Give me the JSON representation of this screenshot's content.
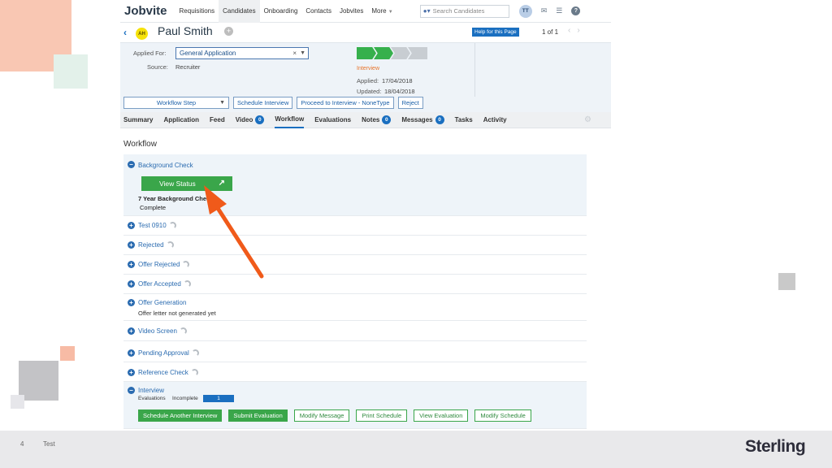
{
  "app": {
    "logo": "Jobvite",
    "nav": [
      "Requisitions",
      "Candidates",
      "Onboarding",
      "Contacts",
      "Jobvites",
      "More"
    ],
    "search_placeholder": "Search Candidates",
    "user_initials": "TT"
  },
  "candidate": {
    "initials": "AH",
    "name": "Paul Smith",
    "help_button": "Help for this Page",
    "pager": "1 of 1"
  },
  "info": {
    "applied_for_label": "Applied For:",
    "applied_for_value": "General Application",
    "source_label": "Source:",
    "source_value": "Recruiter",
    "stage": "Interview",
    "applied_label": "Applied:",
    "applied_date": "17/04/2018",
    "updated_label": "Updated:",
    "updated_date": "18/04/2018",
    "buttons": {
      "workflow_step": "Workflow Step",
      "schedule_interview": "Schedule Interview",
      "proceed": "Proceed to Interview - NoneType",
      "reject": "Reject"
    }
  },
  "tabs": [
    {
      "label": "Summary"
    },
    {
      "label": "Application"
    },
    {
      "label": "Feed"
    },
    {
      "label": "Video",
      "badge": "0"
    },
    {
      "label": "Workflow"
    },
    {
      "label": "Evaluations"
    },
    {
      "label": "Notes",
      "badge": "0"
    },
    {
      "label": "Messages",
      "badge": "0"
    },
    {
      "label": "Tasks"
    },
    {
      "label": "Activity"
    }
  ],
  "workflow": {
    "title": "Workflow",
    "background_check": {
      "name": "Background Check",
      "view_status": "View Status",
      "item": "7 Year Background Check",
      "status": "Complete"
    },
    "steps": [
      "Test 0910",
      "Rejected",
      "Offer Rejected",
      "Offer Accepted",
      "Offer Generation",
      "Video Screen",
      "Pending Approval",
      "Reference Check"
    ],
    "offer_generation_note": "Offer letter not generated yet",
    "interview": {
      "name": "Interview",
      "evaluations_label": "Evaluations",
      "evaluations_status": "Incomplete",
      "progress": "1",
      "actions": [
        "Schedule Another Interview",
        "Submit Evaluation",
        "Modify Message",
        "Print Schedule",
        "View Evaluation",
        "Modify Schedule"
      ]
    }
  },
  "footer": {
    "page_number": "4",
    "text": "Test",
    "brand": "Sterling"
  }
}
